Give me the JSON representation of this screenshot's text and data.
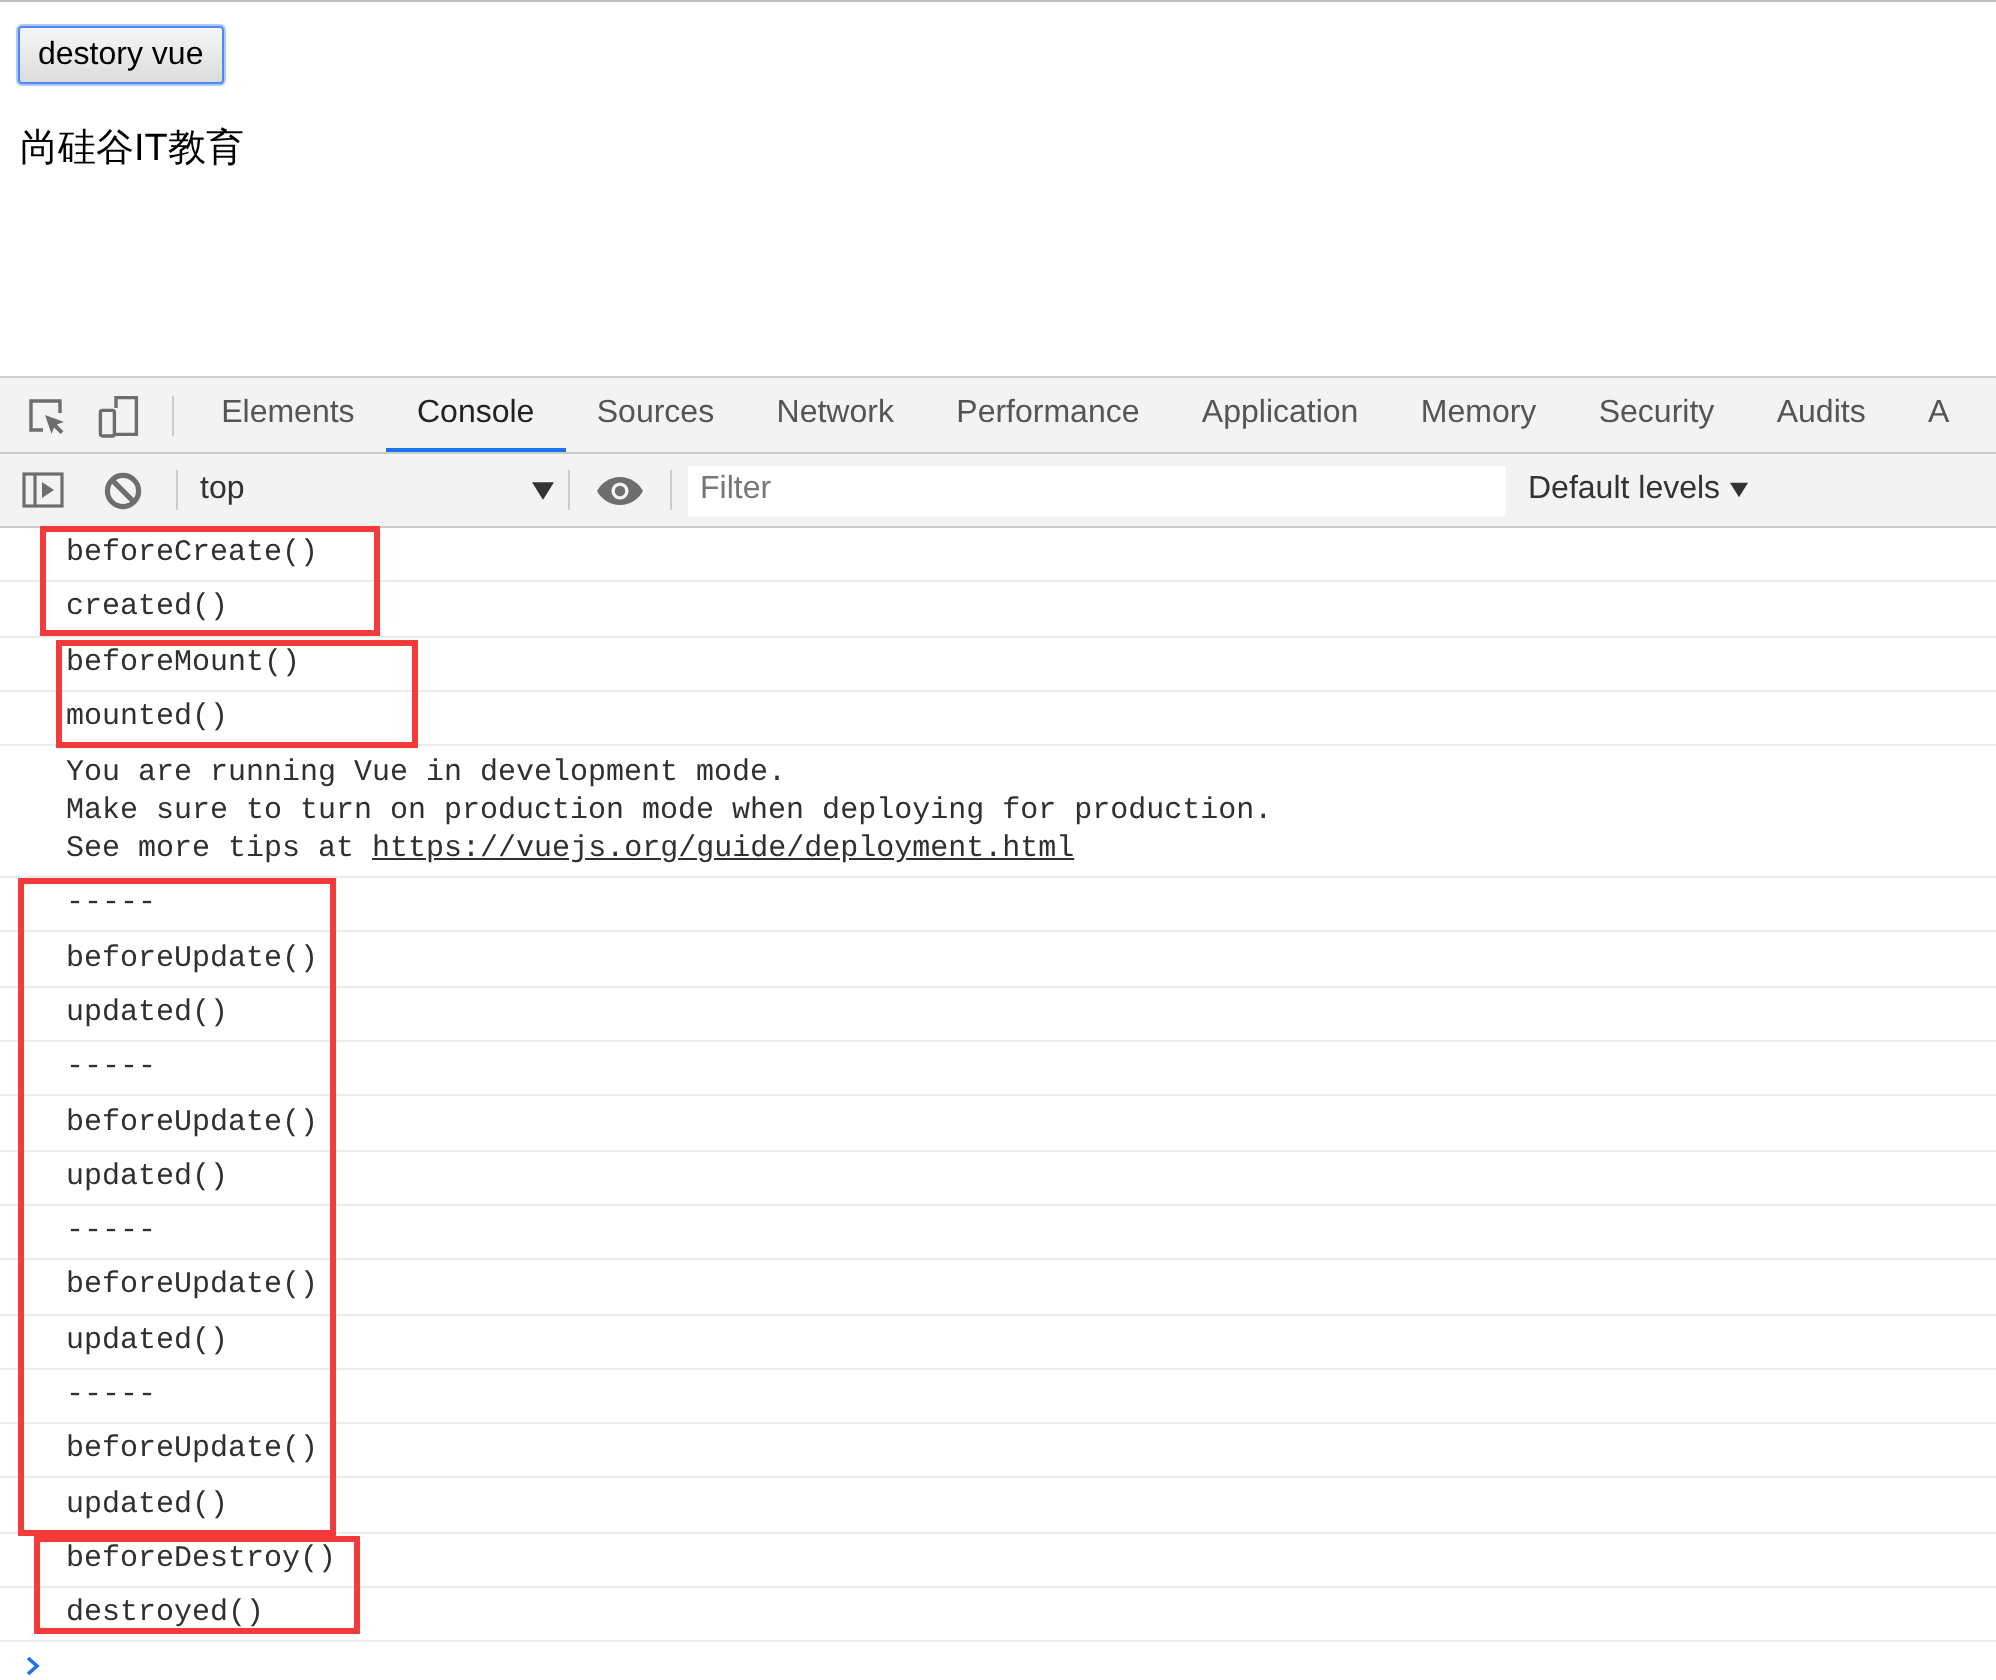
{
  "page": {
    "button": "destory vue",
    "text": "尚硅谷IT教育"
  },
  "devtools": {
    "tabs": [
      {
        "label": "Elements",
        "selected": false
      },
      {
        "label": "Console",
        "selected": true
      },
      {
        "label": "Sources",
        "selected": false
      },
      {
        "label": "Network",
        "selected": false
      },
      {
        "label": "Performance",
        "selected": false
      },
      {
        "label": "Application",
        "selected": false
      },
      {
        "label": "Memory",
        "selected": false
      },
      {
        "label": "Security",
        "selected": false
      },
      {
        "label": "Audits",
        "selected": false
      },
      {
        "label": "A",
        "selected": false
      }
    ],
    "toolbar": {
      "context": "top",
      "filter": {
        "placeholder": "Filter"
      },
      "levels": "Default levels"
    },
    "console": [
      {
        "kind": "rows",
        "highlighted": true,
        "rows": [
          "beforeCreate()",
          "created()"
        ]
      },
      {
        "kind": "rows",
        "highlighted": true,
        "rows": [
          "beforeMount()",
          "mounted()"
        ]
      },
      {
        "kind": "message",
        "highlighted": false,
        "lines": [
          "You are running Vue in development mode.",
          "Make sure to turn on production mode when deploying for production.",
          "See more tips at"
        ],
        "link": "https://vuejs.org/guide/deployment.html"
      },
      {
        "kind": "rows",
        "highlighted": true,
        "rows": [
          "-----",
          "beforeUpdate()",
          "updated()",
          "-----",
          "beforeUpdate()",
          "updated()",
          "-----",
          "beforeUpdate()",
          "updated()",
          "-----",
          "beforeUpdate()",
          "updated()"
        ]
      },
      {
        "kind": "rows",
        "highlighted": true,
        "rows": [
          "beforeDestroy()",
          "destroyed()"
        ]
      }
    ]
  }
}
